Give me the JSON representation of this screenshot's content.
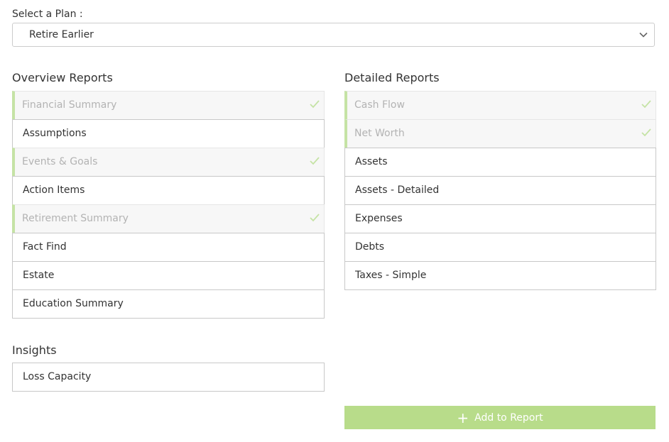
{
  "plan": {
    "label": "Select a Plan :",
    "selected": "Retire Earlier"
  },
  "overview": {
    "title": "Overview Reports",
    "items": [
      {
        "label": "Financial Summary",
        "selected": true
      },
      {
        "label": "Assumptions",
        "selected": false
      },
      {
        "label": "Events & Goals",
        "selected": true
      },
      {
        "label": "Action Items",
        "selected": false
      },
      {
        "label": "Retirement Summary",
        "selected": true
      },
      {
        "label": "Fact Find",
        "selected": false
      },
      {
        "label": "Estate",
        "selected": false
      },
      {
        "label": "Education Summary",
        "selected": false
      }
    ]
  },
  "insights": {
    "title": "Insights",
    "items": [
      {
        "label": "Loss Capacity",
        "selected": false
      }
    ]
  },
  "detailed": {
    "title": "Detailed Reports",
    "items": [
      {
        "label": "Cash Flow",
        "selected": true
      },
      {
        "label": "Net Worth",
        "selected": true
      },
      {
        "label": "Assets",
        "selected": false
      },
      {
        "label": "Assets - Detailed",
        "selected": false
      },
      {
        "label": "Expenses",
        "selected": false
      },
      {
        "label": "Debts",
        "selected": false
      },
      {
        "label": "Taxes - Simple",
        "selected": false
      }
    ]
  },
  "add_button": {
    "icon": "plus-icon",
    "label": "Add to Report"
  },
  "colors": {
    "accent": "#b8dc8a",
    "selected_bar": "#c5e3a5",
    "selected_bg": "#f7f7f7",
    "check": "#c5e3a5"
  }
}
